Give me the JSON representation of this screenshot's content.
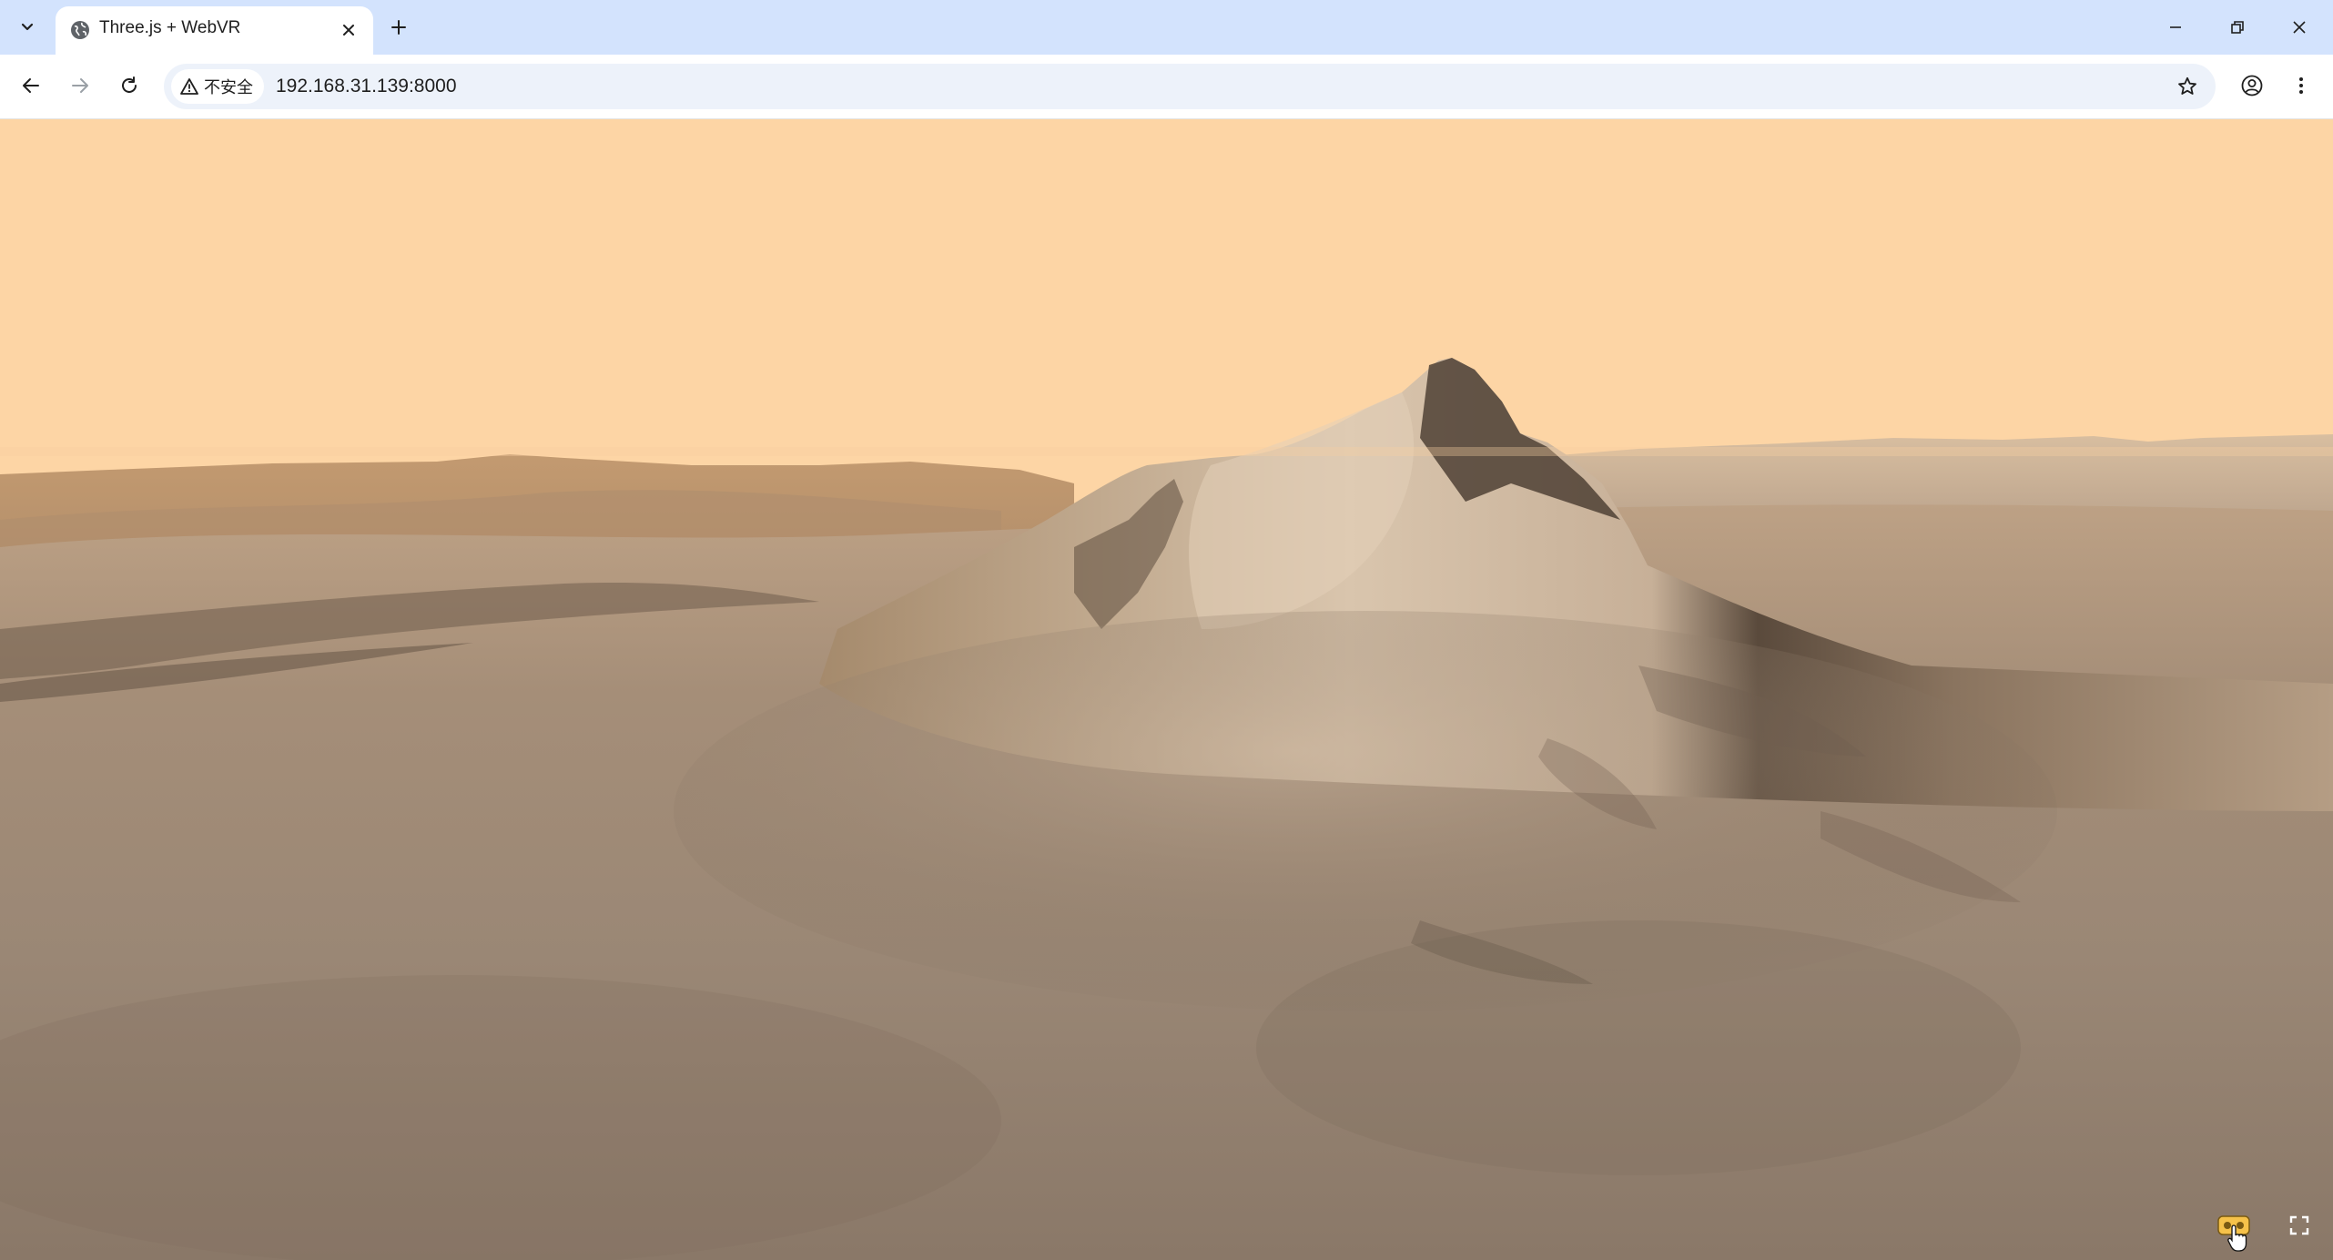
{
  "browser": {
    "tab": {
      "title": "Three.js + WebVR",
      "favicon": "globe-icon",
      "close_icon": "close-icon"
    },
    "icons": {
      "tab_search": "chevron-down-icon",
      "new_tab": "plus-icon",
      "minimize": "minimize-icon",
      "restore": "restore-icon",
      "close_window": "close-icon"
    },
    "toolbar": {
      "back_icon": "arrow-left-icon",
      "forward_icon": "arrow-right-icon",
      "reload_icon": "reload-icon",
      "security_label": "不安全",
      "security_icon": "warning-icon",
      "url": "192.168.31.139:8000",
      "bookmark_icon": "star-icon",
      "profile_icon": "profile-icon",
      "menu_icon": "kebab-menu-icon"
    },
    "colors": {
      "tabstrip_bg": "#d3e3fd",
      "omnibox_bg": "#edf2fa",
      "sky": "#fdd5a5",
      "terrain_light": "#c9b39a",
      "terrain_dark": "#7a6650"
    }
  },
  "scene": {
    "description_icon": "mars-terrain-scene",
    "vr_button_icon": "vr-headset-icon",
    "fullscreen_icon": "fullscreen-icon"
  }
}
